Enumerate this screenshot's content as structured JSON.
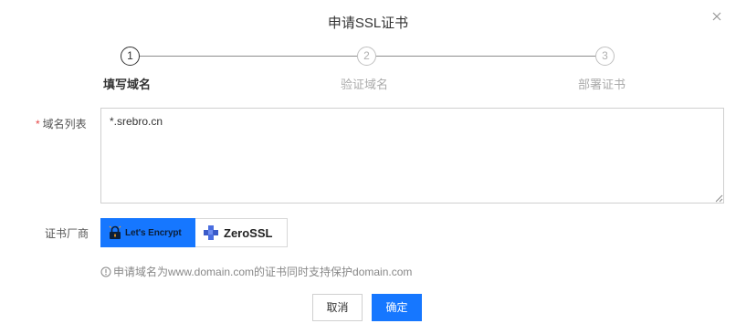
{
  "dialog": {
    "title": "申请SSL证书",
    "close_icon": "close-icon"
  },
  "steps": [
    {
      "number": "1",
      "label": "填写域名",
      "state": "active"
    },
    {
      "number": "2",
      "label": "验证域名",
      "state": "pending"
    },
    {
      "number": "3",
      "label": "部署证书",
      "state": "pending"
    }
  ],
  "form": {
    "domains": {
      "required_mark": "*",
      "label": "域名列表",
      "value": "*.srebro.cn"
    },
    "vendor": {
      "label": "证书厂商",
      "options": [
        {
          "label": "Let's Encrypt",
          "icon": "lets-encrypt-logo",
          "selected": true
        },
        {
          "label": "ZeroSSL",
          "icon": "zerossl-logo",
          "selected": false
        }
      ]
    },
    "hint": {
      "icon": "info-circle-icon",
      "text": "申请域名为www.domain.com的证书同时支持保护domain.com"
    }
  },
  "buttons": {
    "cancel_label": "取消",
    "ok_label": "确定"
  },
  "colors": {
    "primary": "#1677ff",
    "required": "#e54545"
  }
}
